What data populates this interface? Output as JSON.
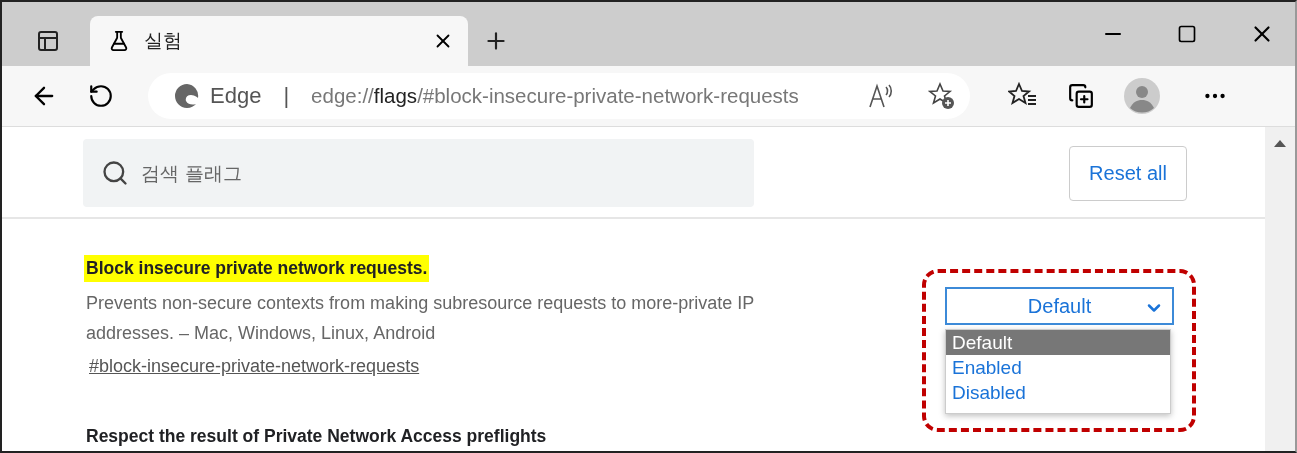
{
  "window": {
    "tabs": [
      {
        "title": "실험",
        "selected": true
      }
    ],
    "address_bar": {
      "site_label": "Edge",
      "separator": "|",
      "url": {
        "scheme": "edge://",
        "host": "flags",
        "path": "/#block-insecure-private-network-requests"
      }
    }
  },
  "search": {
    "placeholder": "검색 플래그"
  },
  "reset_button": "Reset all",
  "flags": [
    {
      "title": "Block insecure private network requests.",
      "highlighted": true,
      "annotated": true,
      "description": "Prevents non-secure contexts from making subresource requests to more-private IP addresses. – Mac, Windows, Linux, Android",
      "link": "#block-insecure-private-network-requests",
      "dropdown": {
        "value": "Default",
        "open": true,
        "options": [
          {
            "label": "Default",
            "selected": true
          },
          {
            "label": "Enabled",
            "selected": false
          },
          {
            "label": "Disabled",
            "selected": false
          }
        ]
      }
    },
    {
      "title": "Respect the result of Private Network Access preflights"
    }
  ]
}
